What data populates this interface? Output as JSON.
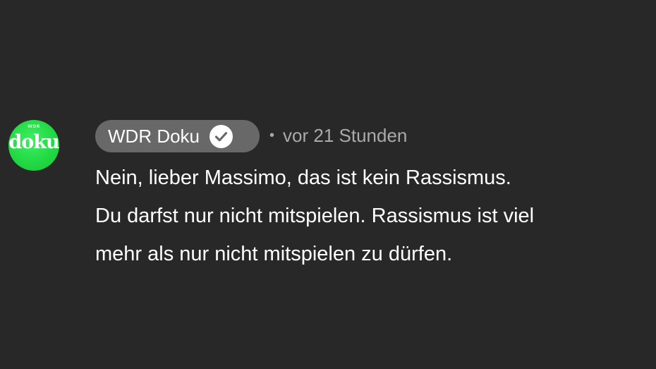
{
  "avatar": {
    "tiny_text": "WDR",
    "text": "doku",
    "color": "#22d945"
  },
  "author": {
    "name": "WDR Doku",
    "badge_icon": "verified-check-icon"
  },
  "meta": {
    "separator": "•",
    "time": "vor 21 Stunden"
  },
  "comment": {
    "lines": [
      "Nein, lieber Massimo, das ist kein Rassismus.",
      "Du darfst nur nicht mitspielen. Rassismus ist viel",
      "mehr als nur nicht mitspielen zu dürfen."
    ]
  },
  "colors": {
    "background": "#282828",
    "chip": "#686868",
    "meta_text": "#aaaaaa"
  }
}
